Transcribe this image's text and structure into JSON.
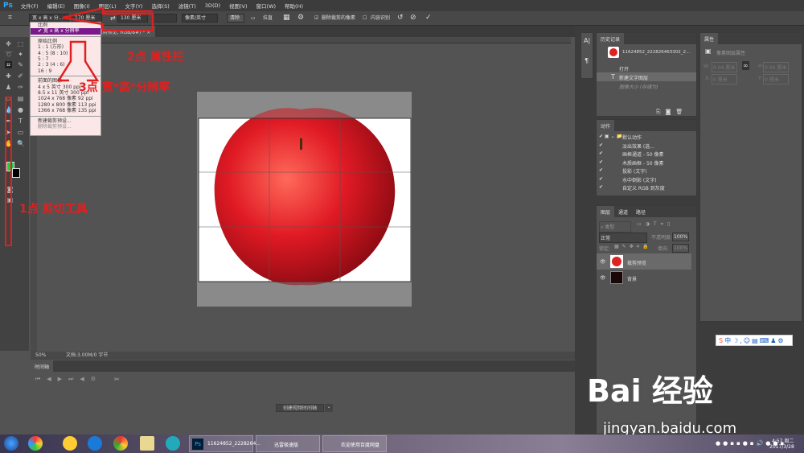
{
  "app": {
    "logo": "Ps",
    "menu": [
      "文件(F)",
      "编辑(E)",
      "图像(I)",
      "图层(L)",
      "文字(Y)",
      "选择(S)",
      "滤镜(T)",
      "3D(D)",
      "视图(V)",
      "窗口(W)",
      "帮助(H)"
    ]
  },
  "options": {
    "preset": "宽 x 高 x 分...",
    "width": "170 厘米",
    "height": "130 厘米",
    "resolution": "",
    "unit": "像素/英寸",
    "clear": "清除",
    "straighten": "拉直",
    "delete_cropped": "删除裁剪的像素",
    "delete_cropped_checked": true,
    "content_aware": "内容识别",
    "content_aware_checked": false
  },
  "document_tab": {
    "title": "@ 50% (裁剪预览, RGB/8#) *",
    "close": "×"
  },
  "crop_dropdown": {
    "items_top": [
      "比例",
      "宽 x 高 x 分辨率"
    ],
    "selected": "宽 x 高 x 分辨率",
    "group_original": [
      "原始比例",
      "1 : 1 (方形)",
      "4 : 5 (8 : 10)",
      "5 : 7",
      "2 : 3 (4 : 6)",
      "16 : 9"
    ],
    "group_front": [
      "前面的图像",
      "4 x 5 英寸 300 ppi",
      "8.5 x 11 英寸 300 ppi",
      "1024 x 768 像素 92 ppi",
      "1280 x 800 像素 113 ppi",
      "1366 x 768 像素 135 ppi"
    ],
    "group_presets": [
      "新建裁剪预设...",
      "删除裁剪预设..."
    ]
  },
  "annotations": {
    "step1": "1点 剪切工具",
    "step2": "2点 属性栏",
    "step3": "3点 宽*高*分辨率"
  },
  "status": {
    "zoom": "50%",
    "doc": "文档:3.00M/0 字节"
  },
  "timeline": {
    "tab": "时间轴",
    "create": "创建视频时间轴"
  },
  "history": {
    "tab": "历史记录",
    "snapshot": "11624852_222826463302_2...",
    "items": [
      "打开",
      "新建文字图层",
      "图像大小 (存储为)"
    ]
  },
  "properties": {
    "tab": "属性",
    "title": "像素图层属性",
    "w_label": "W:",
    "w": "0.04 厘米",
    "h_label": "H:",
    "h": "0.04 厘米",
    "x_label": "X:",
    "x": "0 厘米",
    "y_label": "Y:",
    "y": "0 厘米"
  },
  "actions": {
    "tab": "动作",
    "items": [
      "默认动作",
      "淡出效果 (选...",
      "画框通道 - 50 像素",
      "木质画框 - 50 像素",
      "投影 (文字)",
      "水中倒影 (文字)",
      "自定义 RGB 到灰度"
    ]
  },
  "layers": {
    "tabs": [
      "图层",
      "通道",
      "路径"
    ],
    "filter": "类型",
    "blend": "正常",
    "opacity_label": "不透明度:",
    "opacity": "100%",
    "lock_label": "锁定:",
    "fill_label": "填充:",
    "fill": "100%",
    "items": [
      "裁剪预览",
      "背景"
    ]
  },
  "taskbar": {
    "windows": [
      "11624852_2228264...",
      "迅雷极速版",
      "欢迎使用百度网盘"
    ],
    "time": "4:57 周二",
    "date": "2017/3/28"
  },
  "watermark": {
    "logo": "Bai 经验",
    "url": "jingyan.baidu.com"
  },
  "colors": {
    "accent": "#7a1a8a",
    "annotation": "#e02020",
    "foreground": "#22cc44",
    "background": "#000000"
  }
}
